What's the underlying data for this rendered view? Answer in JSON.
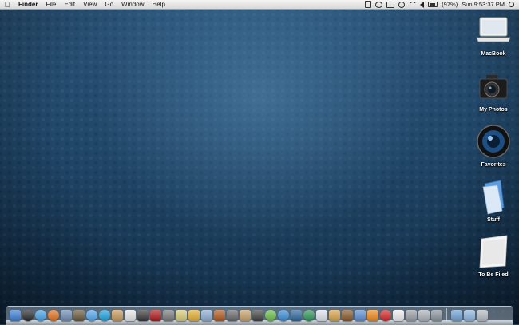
{
  "menubar": {
    "apple_icon": "apple-icon",
    "app_name": "Finder",
    "menus": [
      "File",
      "Edit",
      "View",
      "Go",
      "Window",
      "Help"
    ],
    "status_icons": [
      "ical-icon",
      "chat-icon",
      "display-icon",
      "sync-icon",
      "wifi-icon",
      "volume-icon"
    ],
    "battery": "(97%)",
    "clock": "Sun 9:53:37 PM",
    "spotlight_icon": "spotlight-search-icon"
  },
  "desktop_icons": [
    {
      "label": "MacBook",
      "icon": "macbook-icon"
    },
    {
      "label": "My Photos",
      "icon": "camera-icon"
    },
    {
      "label": "Favorites",
      "icon": "lens-icon"
    },
    {
      "label": "Stuff",
      "icon": "folder-icon"
    },
    {
      "label": "To Be Filed",
      "icon": "paper-icon"
    }
  ],
  "dock": {
    "apps": [
      {
        "name": "finder-icon",
        "color": "#3d7fd6"
      },
      {
        "name": "dashboard-icon",
        "color": "#2b2b2b"
      },
      {
        "name": "safari-icon",
        "color": "#4aa3e8"
      },
      {
        "name": "firefox-icon",
        "color": "#e2731f"
      },
      {
        "name": "preview-icon",
        "color": "#6f8fb5"
      },
      {
        "name": "gimp-icon",
        "color": "#6b5a3a"
      },
      {
        "name": "ichat-icon",
        "color": "#55a7ef"
      },
      {
        "name": "skype-icon",
        "color": "#1fa3e0"
      },
      {
        "name": "notes-icon",
        "color": "#c99a5b"
      },
      {
        "name": "ical-icon",
        "color": "#e9e9e9"
      },
      {
        "name": "camera-app-icon",
        "color": "#3a3a3a"
      },
      {
        "name": "photobooth-icon",
        "color": "#b21a1a"
      },
      {
        "name": "app-icon-12",
        "color": "#7c7c7c"
      },
      {
        "name": "app-icon-13",
        "color": "#d8cf7a"
      },
      {
        "name": "app-icon-14",
        "color": "#e6b030"
      },
      {
        "name": "iphoto-icon",
        "color": "#8fb0d5"
      },
      {
        "name": "app-icon-16",
        "color": "#b35a1e"
      },
      {
        "name": "app-icon-17",
        "color": "#6a6a6a"
      },
      {
        "name": "garageband-icon",
        "color": "#caa26a"
      },
      {
        "name": "app-icon-19",
        "color": "#444444"
      },
      {
        "name": "app-icon-20",
        "color": "#6cc04a"
      },
      {
        "name": "app-icon-21",
        "color": "#3a8ed8"
      },
      {
        "name": "app-icon-22",
        "color": "#2c6aa0"
      },
      {
        "name": "app-icon-23",
        "color": "#2f9a5a"
      },
      {
        "name": "app-icon-24",
        "color": "#e0e6ee"
      },
      {
        "name": "app-icon-25",
        "color": "#d8a44a"
      },
      {
        "name": "app-icon-26",
        "color": "#8b5a2b"
      },
      {
        "name": "app-icon-27",
        "color": "#5f8fd0"
      },
      {
        "name": "vlc-icon",
        "color": "#f08a1c"
      },
      {
        "name": "stop-icon",
        "color": "#d62a2a"
      },
      {
        "name": "app-icon-30",
        "color": "#f0f0f0"
      },
      {
        "name": "app-icon-31",
        "color": "#9aa0a8"
      },
      {
        "name": "app-icon-32",
        "color": "#b0b4ba"
      },
      {
        "name": "app-icon-33",
        "color": "#8c95a0"
      }
    ],
    "stacks": [
      {
        "name": "applications-stack-icon",
        "color": "#6fa3d6"
      },
      {
        "name": "documents-stack-icon",
        "color": "#8fb8e0"
      },
      {
        "name": "trash-icon",
        "color": "#b8bec6"
      }
    ]
  }
}
